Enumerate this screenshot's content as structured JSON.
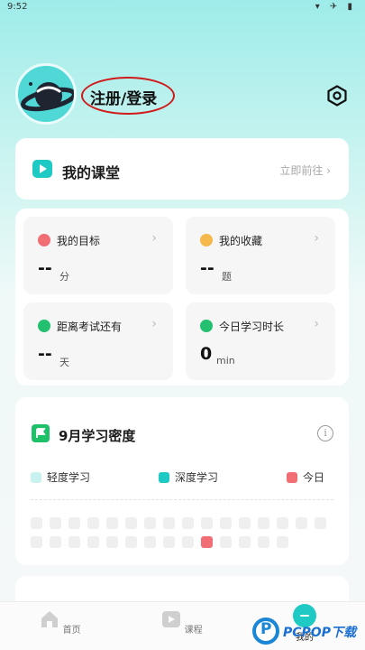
{
  "status_bar": {
    "time": "9:52",
    "icons": "▾ ✈ ▮"
  },
  "profile": {
    "login_label": "注册/登录"
  },
  "course_card": {
    "title": "我的课堂",
    "action": "立即前往 ›"
  },
  "stats": [
    {
      "label": "我的目标",
      "value": "--",
      "unit": "分",
      "icon": "target-icon",
      "color": "#f06e74"
    },
    {
      "label": "我的收藏",
      "value": "--",
      "unit": "题",
      "icon": "star-icon",
      "color": "#f5b84a"
    },
    {
      "label": "距离考试还有",
      "value": "--",
      "unit": "天",
      "icon": "clock-icon",
      "color": "#23c06f"
    },
    {
      "label": "今日学习时长",
      "value": "0",
      "unit": "min",
      "icon": "pencil-icon",
      "color": "#23c06f"
    }
  ],
  "chevron": "›",
  "density": {
    "title": "9月学习密度",
    "info_icon": "i",
    "legend": [
      {
        "label": "轻度学习",
        "color": "#c8f1ef"
      },
      {
        "label": "深度学习",
        "color": "#1fc9c4"
      },
      {
        "label": "今日",
        "color": "#f06e74"
      }
    ],
    "today_index": 25,
    "days": 30
  },
  "bottom_nav": {
    "home": "首页",
    "courses": "课程",
    "mine": "我的"
  },
  "watermark": {
    "text": "PCPOP下载"
  }
}
